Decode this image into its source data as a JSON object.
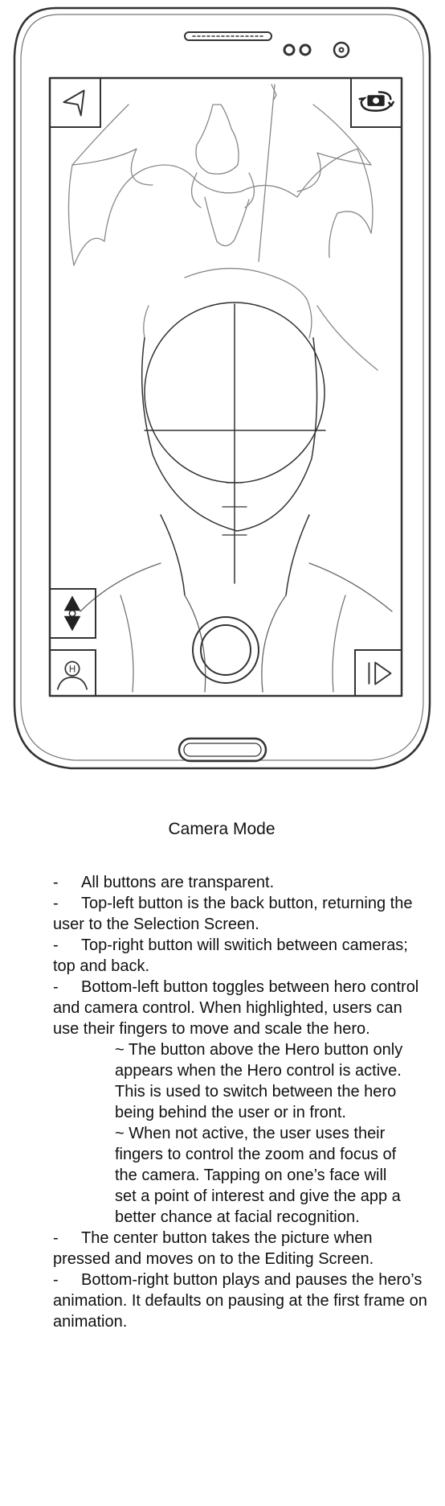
{
  "screen": {
    "title": "Camera Mode",
    "buttons": {
      "back": "back-arrow-icon",
      "camera_switch": "camera-switch-icon",
      "depth_toggle": "up-down-arrow-icon",
      "hero_toggle": "hero-person-icon",
      "hero_icon_letter": "H",
      "shutter": "shutter-circle-icon",
      "play_pause": "play-icon"
    }
  },
  "notes": {
    "dash": "-",
    "items": [
      "All buttons are transparent.",
      "Top-left button is the back button, returning the user to the Selection Screen.",
      "Top-right button will switich between cameras; top and back.",
      "Bottom-left button toggles between hero control and camera control. When highlighted, users can use their fingers to move and scale the hero.",
      "The center button takes the picture when pressed and moves on to the Editing Screen.",
      "Bottom-right button plays and pauses the hero’s animation. It defaults on pausing at the first frame on animation."
    ],
    "subitems": [
      "~ The button above the Hero button only appears when the Hero control is active. This is used to switch between the hero being behind the user or in front.",
      "~ When not active, the user uses their fingers to control the zoom and focus of the camera. Tapping on one’s face will set a point of interest and give the app a better chance at facial recognition."
    ]
  }
}
